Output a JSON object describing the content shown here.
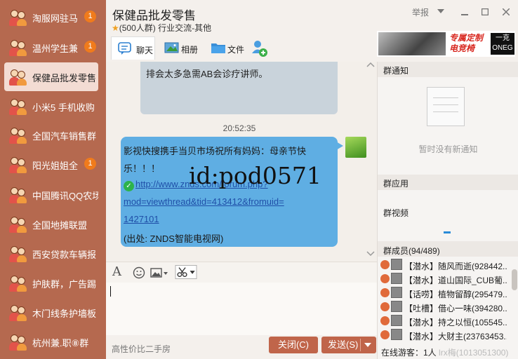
{
  "sidebar": {
    "items": [
      {
        "label": "淘服网驻马",
        "badge": "1"
      },
      {
        "label": "温州学生兼",
        "badge": "1"
      },
      {
        "label": "保健品批发零售",
        "badge": ""
      },
      {
        "label": "小米5 手机收购",
        "badge": ""
      },
      {
        "label": "全国汽车销售群",
        "badge": ""
      },
      {
        "label": "阳光姐姐全",
        "badge": "1"
      },
      {
        "label": "中国腾讯QQ农场",
        "badge": ""
      },
      {
        "label": "全国地摊联盟",
        "badge": ""
      },
      {
        "label": "西安贷款车辆报",
        "badge": ""
      },
      {
        "label": "护肤群，广告踢",
        "badge": ""
      },
      {
        "label": "木门线条护墙板",
        "badge": ""
      },
      {
        "label": "杭州兼.职⑧群",
        "badge": ""
      }
    ]
  },
  "header": {
    "title": "保健品批发零售",
    "subtitle_star": "★",
    "subtitle": "(500人群) 行业交流-其他",
    "report": "举报",
    "tabs": [
      {
        "label": "聊天"
      },
      {
        "label": "相册"
      },
      {
        "label": "文件"
      }
    ],
    "ad_text_1": "专属定制",
    "ad_text_2": "电竞椅",
    "ad_logo_1": "一克",
    "ad_logo_2": "ONEG"
  },
  "chat": {
    "prev_message": "排会太多急需AB会诊疗讲师。",
    "timestamp": "20:52:35",
    "message_lines": [
      "影视快搜携手当贝市场祝所有妈妈：母亲节快",
      "乐！！！",
      "http://www.znds.com/forum.php?",
      "mod=viewthread&tid=413412&fromuid=",
      "1427101",
      "(出处: ZNDS智能电视网)"
    ],
    "watermark": "id:pod0571"
  },
  "input": {
    "hint": "高性价比二手房",
    "close_label": "关闭(C)",
    "send_label": "发送(S)"
  },
  "right": {
    "notice_title": "群通知",
    "notice_empty": "暂时没有新通知",
    "apps_title": "群应用",
    "video_label": "群视频",
    "members_title": "群成员(94/489)",
    "members": [
      "【潜水】随风而逝(928442...",
      "【潜水】道山国际_CUB葡...",
      "【话唠】植物留醇(295479...",
      "【吐槽】借心一味(394280...",
      "【潜水】持之以恒(105545...",
      "【潜水】大财主(23763453..."
    ],
    "online_label": "在线游客：1人",
    "online_hidden": "lrx梅(1013051300)"
  }
}
